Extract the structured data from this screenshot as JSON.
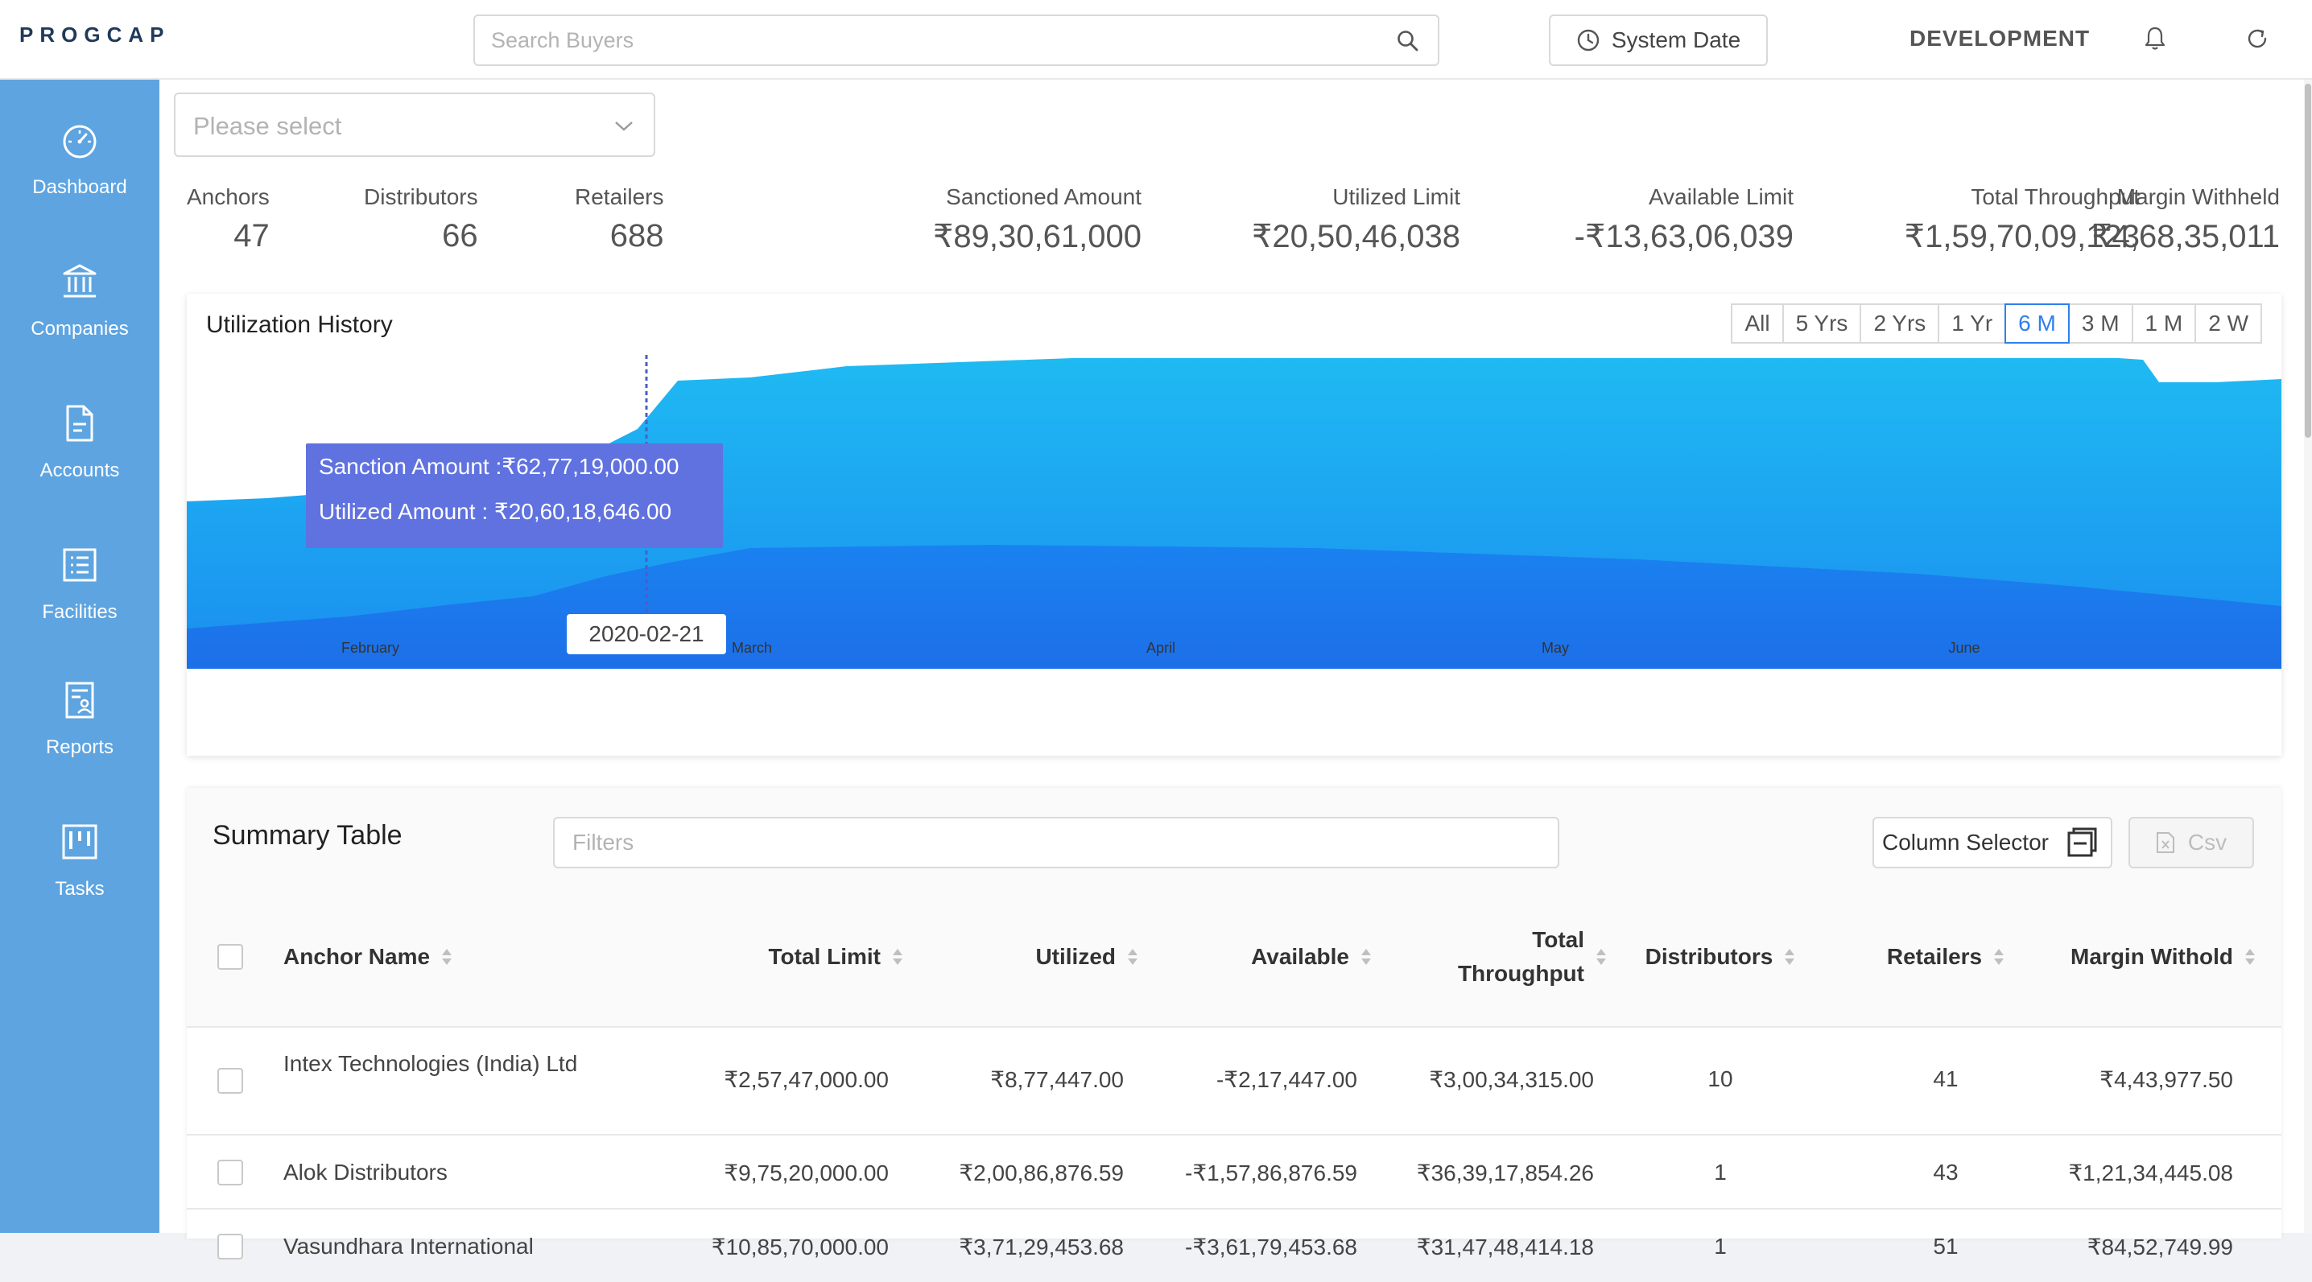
{
  "brand": {
    "logo_text": "PROGCAP",
    "accent": "#2196f3"
  },
  "header": {
    "search_placeholder": "Search Buyers",
    "system_date_label": "System Date",
    "environment": "DEVELOPMENT"
  },
  "sidebar": {
    "color": "#5ea4e0",
    "items": [
      {
        "label": "Dashboard",
        "icon": "dashboard-gauge-icon"
      },
      {
        "label": "Companies",
        "icon": "bank-building-icon"
      },
      {
        "label": "Accounts",
        "icon": "document-icon"
      },
      {
        "label": "Facilities",
        "icon": "list-icon"
      },
      {
        "label": "Reports",
        "icon": "report-user-icon"
      },
      {
        "label": "Tasks",
        "icon": "kanban-icon"
      }
    ]
  },
  "filter_select": {
    "placeholder": "Please select"
  },
  "stats": [
    {
      "label": "Anchors",
      "value": "47"
    },
    {
      "label": "Distributors",
      "value": "66"
    },
    {
      "label": "Retailers",
      "value": "688"
    },
    {
      "label": "Sanctioned Amount",
      "value": "₹89,30,61,000"
    },
    {
      "label": "Utilized Limit",
      "value": "₹20,50,46,038"
    },
    {
      "label": "Available Limit",
      "value": "-₹13,63,06,039"
    },
    {
      "label": "Total Throughput",
      "value": "₹1,59,70,09,123"
    },
    {
      "label": "Margin Withheld",
      "value": "₹4,68,35,011"
    }
  ],
  "chart": {
    "title": "Utilization History",
    "ranges": [
      "All",
      "5 Yrs",
      "2 Yrs",
      "1 Yr",
      "6 M",
      "3 M",
      "1 M",
      "2 W"
    ],
    "active_range": "6 M",
    "tooltip": {
      "line1": "Sanction Amount :₹62,77,19,000.00",
      "line2": "Utilized Amount : ₹20,60,18,646.00",
      "date": "2020-02-21"
    }
  },
  "chart_data": {
    "type": "area",
    "title": "Utilization History",
    "x_labels": [
      "February",
      "March",
      "April",
      "May",
      "June"
    ],
    "series": [
      {
        "name": "Sanction Amount",
        "color": "#1ab1ef"
      },
      {
        "name": "Utilized Amount",
        "color": "#1a7ff0"
      }
    ],
    "highlight": {
      "date": "2020-02-21",
      "Sanction Amount": 627719000,
      "Utilized Amount": 206018646
    }
  },
  "summary_table": {
    "title": "Summary Table",
    "filters_placeholder": "Filters",
    "column_selector_label": "Column Selector",
    "csv_label": "Csv",
    "columns": [
      {
        "label": "Anchor Name"
      },
      {
        "label": "Total Limit"
      },
      {
        "label": "Utilized"
      },
      {
        "label": "Available"
      },
      {
        "label": "Total Throughput"
      },
      {
        "label": "Distributors"
      },
      {
        "label": "Retailers"
      },
      {
        "label": "Margin Withold"
      }
    ],
    "rows": [
      {
        "anchor": "Intex Technologies (India) Ltd",
        "total_limit": "₹2,57,47,000.00",
        "utilized": "₹8,77,447.00",
        "available": "-₹2,17,447.00",
        "throughput": "₹3,00,34,315.00",
        "distributors": "10",
        "retailers": "41",
        "margin": "₹4,43,977.50"
      },
      {
        "anchor": "Alok Distributors",
        "total_limit": "₹9,75,20,000.00",
        "utilized": "₹2,00,86,876.59",
        "available": "-₹1,57,86,876.59",
        "throughput": "₹36,39,17,854.26",
        "distributors": "1",
        "retailers": "43",
        "margin": "₹1,21,34,445.08"
      },
      {
        "anchor": "Vasundhara International",
        "total_limit": "₹10,85,70,000.00",
        "utilized": "₹3,71,29,453.68",
        "available": "-₹3,61,79,453.68",
        "throughput": "₹31,47,48,414.18",
        "distributors": "1",
        "retailers": "51",
        "margin": "₹84,52,749.99"
      }
    ]
  }
}
